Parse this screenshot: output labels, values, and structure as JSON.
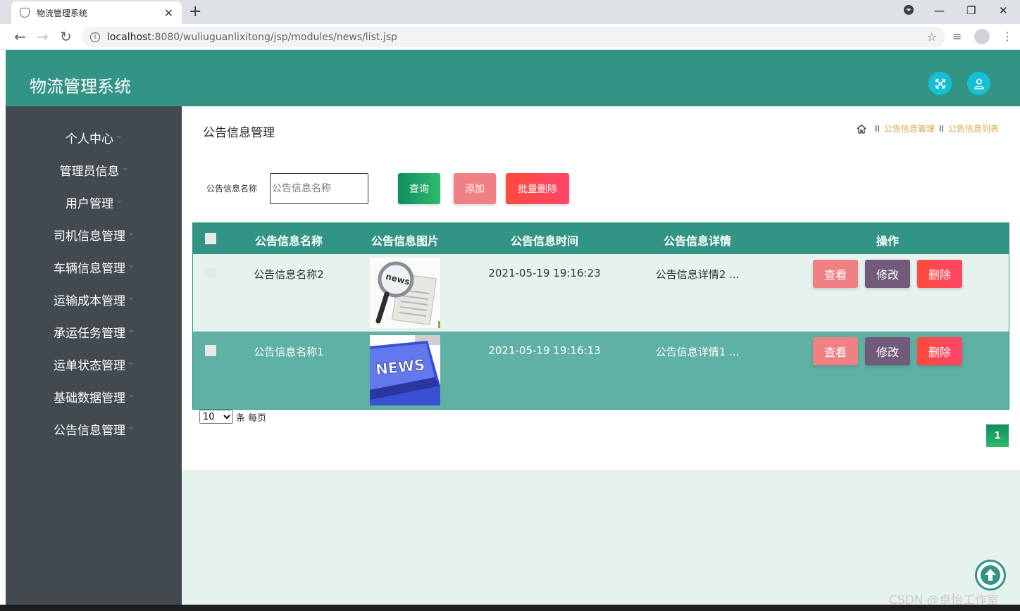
{
  "browser": {
    "tab_title": "物流管理系统",
    "url_host": "localhost",
    "url_rest": ":8080/wuliuguanlixitong/jsp/modules/news/list.jsp"
  },
  "app": {
    "title": "物流管理系统"
  },
  "sidebar": {
    "items": [
      {
        "label": "个人中心"
      },
      {
        "label": "管理员信息"
      },
      {
        "label": "用户管理"
      },
      {
        "label": "司机信息管理"
      },
      {
        "label": "车辆信息管理"
      },
      {
        "label": "运输成本管理"
      },
      {
        "label": "承运任务管理"
      },
      {
        "label": "运单状态管理"
      },
      {
        "label": "基础数据管理"
      },
      {
        "label": "公告信息管理"
      }
    ]
  },
  "page": {
    "title": "公告信息管理",
    "breadcrumb": [
      "公告信息管理",
      "公告信息列表"
    ],
    "breadcrumb_sep": "II"
  },
  "search": {
    "label": "公告信息名称",
    "placeholder": "公告信息名称",
    "query_label": "查询",
    "add_label": "添加",
    "bulk_delete_label": "批量删除"
  },
  "table": {
    "headers": [
      "公告信息名称",
      "公告信息图片",
      "公告信息时间",
      "公告信息详情",
      "操作"
    ],
    "rows": [
      {
        "name": "公告信息名称2",
        "image": "news-magnifier",
        "time": "2021-05-19 19:16:23",
        "detail": "公告信息详情2 ..."
      },
      {
        "name": "公告信息名称1",
        "image": "news-key",
        "time": "2021-05-19 19:16:13",
        "detail": "公告信息详情1 ..."
      }
    ],
    "actions": {
      "view": "查看",
      "edit": "修改",
      "delete": "删除"
    }
  },
  "pagination": {
    "page_size": "10",
    "page_size_suffix": "条 每页",
    "current_page": "1"
  },
  "watermark": "CSDN @卓怡工作室"
}
